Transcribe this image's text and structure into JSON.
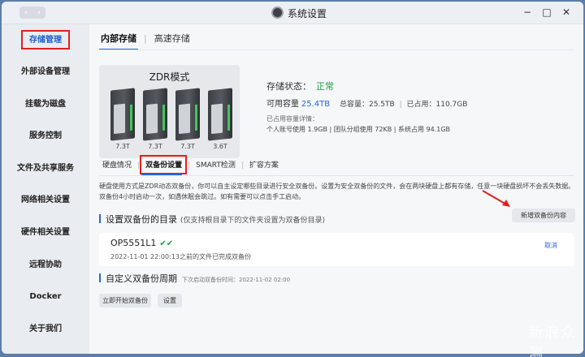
{
  "titlebar": {
    "title": "系统设置",
    "back_icon": "‹",
    "forward_icon": "›",
    "minimize_icon": "−",
    "maximize_icon": "□",
    "close_icon": "✕"
  },
  "sidebar": {
    "items": [
      {
        "label": "存储管理",
        "active": true
      },
      {
        "label": "外部设备管理"
      },
      {
        "label": "挂载为磁盘"
      },
      {
        "label": "服务控制"
      },
      {
        "label": "文件及共享服务"
      },
      {
        "label": "网络相关设置"
      },
      {
        "label": "硬件相关设置"
      },
      {
        "label": "远程协助"
      },
      {
        "label": "Docker"
      },
      {
        "label": "关于我们"
      }
    ]
  },
  "tabs": [
    {
      "label": "内部存储",
      "active": true
    },
    {
      "label": "高速存储"
    }
  ],
  "disk_panel": {
    "mode": "ZDR模式",
    "disks": [
      "7.3T",
      "7.3T",
      "7.3T",
      "3.6T"
    ]
  },
  "status": {
    "label": "存储状态：",
    "value": "正常",
    "available_label": "可用容量",
    "available_value": "25.4TB",
    "total": "总容量：25.5TB",
    "used": "已占用：110.7GB",
    "detail_label": "已占用容量详情：",
    "detail_value": "个人账号使用 1.9GB | 团队分组使用 72KB | 系统占用 94.1GB"
  },
  "subtabs": [
    {
      "label": "硬盘情况"
    },
    {
      "label": "双备份设置",
      "active": true
    },
    {
      "label": "SMART检测"
    },
    {
      "label": "扩容方案"
    }
  ],
  "description": "硬盘使用方式是ZDR动态双备份，你可以自主设定哪些目录进行安全双备份。设置为安全双备份的文件，会在两块硬盘上都有存储，任意一块硬盘损坏不会丢失数据。双备份4小时启动一次，如遇休眠会跳过。如有需要可以点击手工启动。",
  "backup_dirs": {
    "title": "设置双备份的目录",
    "hint": "(仅支持根目录下的文件夹设置为双备份目录)",
    "add_button": "新增双备份内容",
    "item": {
      "name": "OP5551L1",
      "checks": "✔✔",
      "time": "2022-11-01 22:00:13之前的文件已完成双备份",
      "cancel": "取消"
    }
  },
  "schedule": {
    "title": "自定义双备份周期",
    "next_time": "下次启动双备份时间：2022-11-02 02:00",
    "start_button": "立即开始双备份",
    "settings_button": "设置"
  },
  "watermark": "新浪众测",
  "colors": {
    "accent": "#2a66d9",
    "ok": "#1ea043",
    "highlight": "#e02020"
  }
}
